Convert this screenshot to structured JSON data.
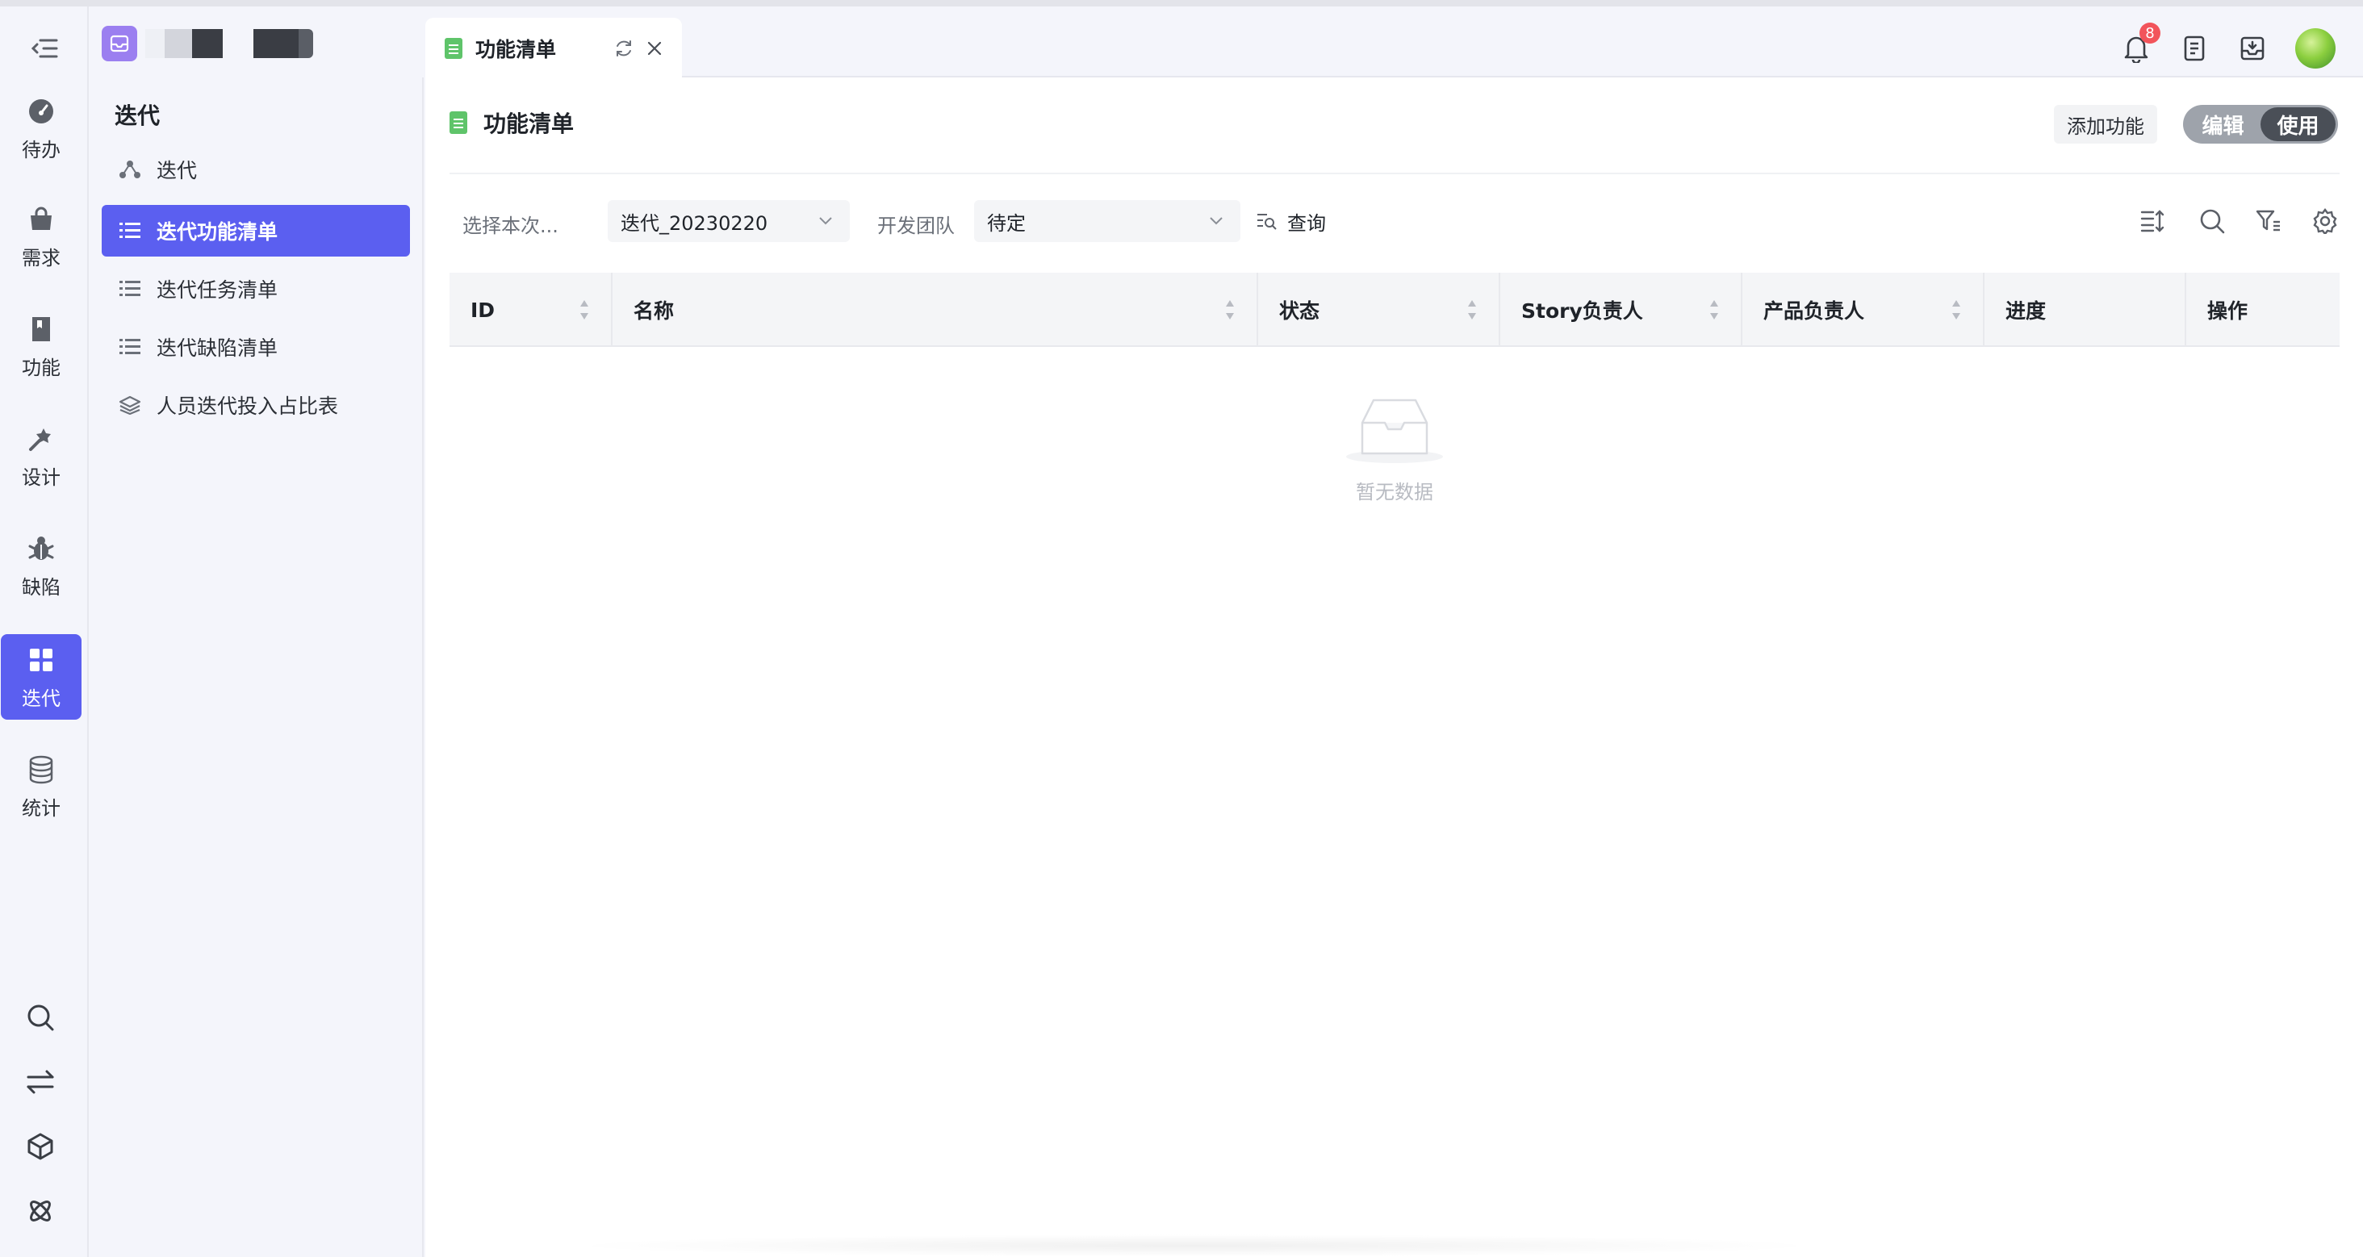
{
  "rail": {
    "items": [
      {
        "label": "待办",
        "icon": "dashboard-icon"
      },
      {
        "label": "需求",
        "icon": "bag-icon"
      },
      {
        "label": "功能",
        "icon": "book-icon"
      },
      {
        "label": "设计",
        "icon": "magic-wand-icon"
      },
      {
        "label": "缺陷",
        "icon": "bug-icon"
      },
      {
        "label": "迭代",
        "icon": "grid-icon",
        "active": true
      },
      {
        "label": "统计",
        "icon": "database-icon"
      }
    ],
    "bottom_icons": [
      "search-icon",
      "swap-icon",
      "cube-icon",
      "atom-icon"
    ]
  },
  "sidebar": {
    "title": "迭代",
    "items": [
      {
        "label": "迭代",
        "icon": "nodes-icon"
      },
      {
        "label": "迭代功能清单",
        "icon": "list-icon",
        "active": true
      },
      {
        "label": "迭代任务清单",
        "icon": "list-icon"
      },
      {
        "label": "迭代缺陷清单",
        "icon": "list-icon"
      },
      {
        "label": "人员迭代投入占比表",
        "icon": "layers-icon"
      }
    ]
  },
  "tab": {
    "label": "功能清单"
  },
  "header": {
    "notification_count": "8"
  },
  "main": {
    "title": "功能清单",
    "add_button": "添加功能",
    "mode": {
      "edit": "编辑",
      "use": "使用",
      "selected": "use"
    },
    "filters": {
      "iteration_label": "选择本次...",
      "iteration_value": "迭代_20230220",
      "team_label": "开发团队",
      "team_value": "待定",
      "query_label": "查询"
    },
    "table": {
      "columns": [
        "ID",
        "名称",
        "状态",
        "Story负责人",
        "产品负责人",
        "进度",
        "操作"
      ],
      "rows": [],
      "empty_text": "暂无数据"
    }
  },
  "colors": {
    "accent": "#5b5ff0",
    "badge": "#f2545b",
    "doc": "#5fc46a"
  }
}
